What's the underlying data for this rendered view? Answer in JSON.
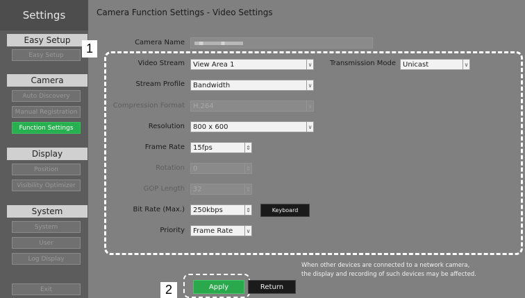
{
  "sidebar": {
    "title": "Settings",
    "sections": [
      {
        "heading": "Easy Setup",
        "items": [
          "Easy Setup"
        ]
      },
      {
        "heading": "Camera",
        "items": [
          "Auto Discovery",
          "Manual Registration",
          "Function Settings"
        ]
      },
      {
        "heading": "Display",
        "items": [
          "Position",
          "Visibility Optimizer"
        ]
      },
      {
        "heading": "System",
        "items": [
          "System",
          "User",
          "Log Display"
        ]
      }
    ],
    "exit_label": "Exit",
    "active_item": "Function Settings",
    "active_color": "#27b04f"
  },
  "page_title": "Camera Function Settings - Video Settings",
  "form": {
    "camera_name": {
      "label": "Camera Name",
      "value": "(blurred)"
    },
    "video_stream": {
      "label": "Video Stream",
      "value": "View Area 1"
    },
    "transmission_mode": {
      "label": "Transmission Mode",
      "value": "Unicast"
    },
    "stream_profile": {
      "label": "Stream Profile",
      "value": "Bandwidth"
    },
    "compression_format": {
      "label": "Compression Format",
      "value": "H.264"
    },
    "resolution": {
      "label": "Resolution",
      "value": "800 x 600"
    },
    "frame_rate": {
      "label": "Frame Rate",
      "value": "15fps"
    },
    "rotation": {
      "label": "Rotation",
      "value": "0"
    },
    "gop_length": {
      "label": "GOP Length",
      "value": "32"
    },
    "bit_rate": {
      "label": "Bit Rate (Max.)",
      "value": "250kbps"
    },
    "keyboard_label": "Keyboard",
    "priority": {
      "label": "Priority",
      "value": "Frame Rate"
    }
  },
  "note": {
    "line1": "When other devices are connected to a network camera,",
    "line2": "the display and recording of such devices may be affected."
  },
  "actions": {
    "apply": "Apply",
    "return": "Return",
    "apply_color": "#2aa84c"
  },
  "callouts": {
    "one": "1",
    "two": "2"
  }
}
